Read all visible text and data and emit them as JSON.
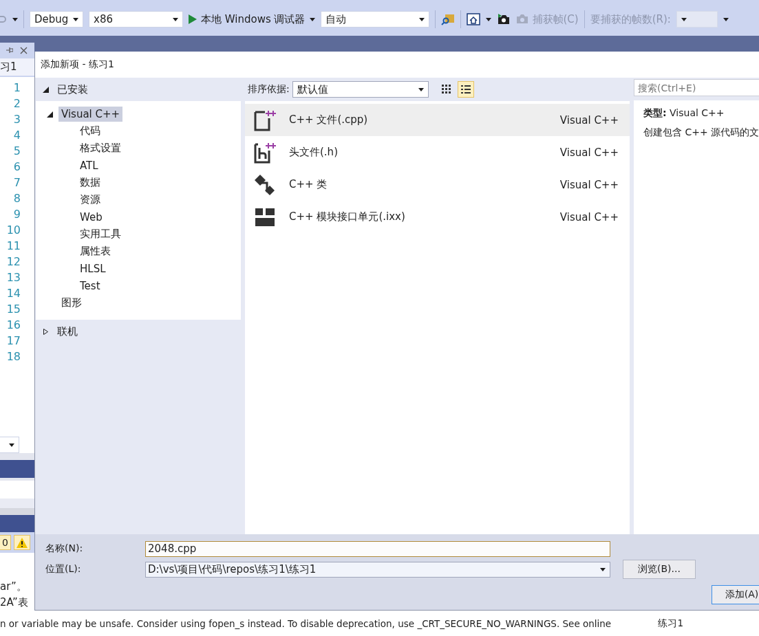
{
  "toolbar": {
    "configuration": "Debug",
    "platform": "x86",
    "debugger": "本地 Windows 调试器",
    "mode": "自动",
    "capture_button": {
      "label": "捕获帧(C)",
      "disabled": true
    },
    "frame_count_label": "要捕获的帧数(R):"
  },
  "editor": {
    "tab_title": "习1",
    "line_numbers": [
      "1",
      "2",
      "3",
      "4",
      "5",
      "6",
      "7",
      "8",
      "9",
      "10",
      "11",
      "12",
      "13",
      "14",
      "15",
      "16",
      "17",
      "18"
    ],
    "error_count": "0",
    "output_lines": [
      "ar”。",
      "2A”表"
    ],
    "status_message": "n or variable may be unsafe. Consider using fopen_s instead. To disable deprecation, use _CRT_SECURE_NO_WARNINGS. See online",
    "project_label": "练习1"
  },
  "dialog": {
    "title": "添加新项 - 练习1",
    "categories": [
      {
        "label": "已安装",
        "expanded": true,
        "children": [
          {
            "label": "Visual C++",
            "expanded": true,
            "selected": true,
            "children": [
              {
                "label": "代码",
                "selected": false
              },
              {
                "label": "格式设置",
                "selected": false
              },
              {
                "label": "ATL",
                "selected": false
              },
              {
                "label": "数据",
                "selected": false
              },
              {
                "label": "资源",
                "selected": false
              },
              {
                "label": "Web",
                "selected": false
              },
              {
                "label": "实用工具",
                "selected": false
              },
              {
                "label": "属性表",
                "selected": false
              },
              {
                "label": "HLSL",
                "selected": false
              },
              {
                "label": "Test",
                "selected": false
              }
            ]
          },
          {
            "label": "图形",
            "selected": false
          }
        ]
      },
      {
        "label": "联机",
        "expanded": false
      }
    ],
    "sort_label": "排序依据:",
    "sort_value": "默认值",
    "view_modes": [
      {
        "kind": "grid",
        "selected": false
      },
      {
        "kind": "list",
        "selected": true
      }
    ],
    "search": {
      "placeholder": "搜索(Ctrl+E)"
    },
    "templates": [
      {
        "kind": "source",
        "name": "C++ 文件(.cpp)",
        "language": "Visual C++",
        "selected": true
      },
      {
        "kind": "header",
        "name": "头文件(.h)",
        "language": "Visual C++",
        "selected": false
      },
      {
        "kind": "class",
        "name": "C++ 类",
        "language": "Visual C++",
        "selected": false
      },
      {
        "kind": "module",
        "name": "C++ 模块接口单元(.ixx)",
        "language": "Visual C++",
        "selected": false
      }
    ],
    "details": {
      "type_line": "**类型:**  Visual C++",
      "description": "创建包含 C++ 源代码的文"
    },
    "name_field": {
      "label": "名称(N):",
      "value": "2048.cpp"
    },
    "location_field": {
      "label": "位置(L):",
      "value": "D:\\vs\\项目\\代码\\repos\\练习1\\练习1"
    },
    "browse_button": "浏览(B)...",
    "add_button": "添加(A)"
  }
}
